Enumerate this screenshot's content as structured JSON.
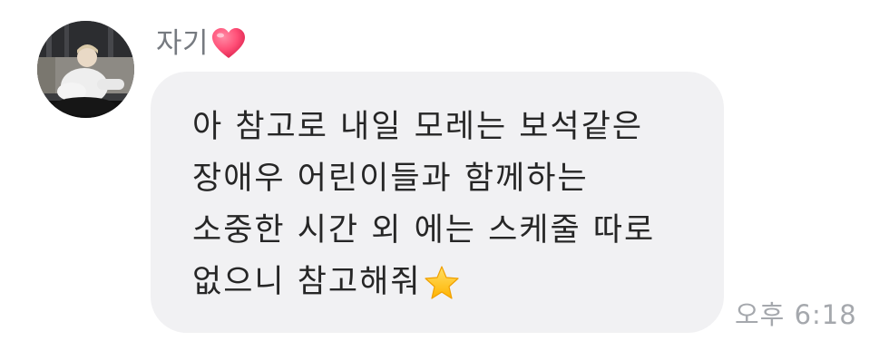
{
  "sender": {
    "name": "자기",
    "emoji": "heart-emoji"
  },
  "message": {
    "lines": [
      "아 참고로 내일 모레는 보석같은",
      "장애우 어린이들과 함께하는",
      "소중한 시간 외 에는 스케줄 따로",
      "없으니 참고해줘"
    ],
    "trailing_emoji": "star-emoji",
    "time": "오후 6:18"
  },
  "colors": {
    "bubble": "#f1f1f3",
    "text": "#262626",
    "sender": "#767a80",
    "timestamp": "#a5a8ad",
    "heart": "#ff4f77",
    "star": "#ffc21c"
  }
}
